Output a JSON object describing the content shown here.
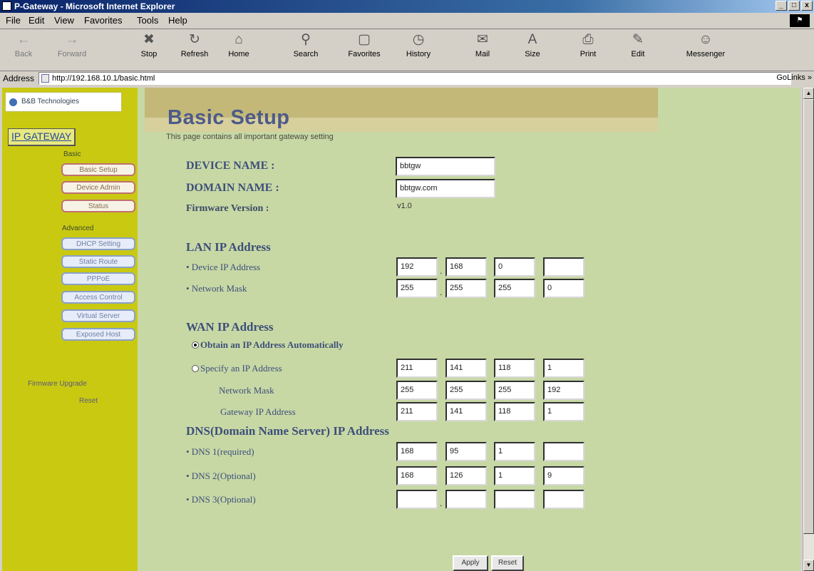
{
  "window": {
    "title": "P-Gateway - Microsoft Internet Explorer",
    "min": "_",
    "max": "□",
    "close": "x"
  },
  "menu": {
    "file": "File",
    "edit": "Edit",
    "view": "View",
    "favorites": "Favorites",
    "tools": "Tools",
    "help": "Help"
  },
  "toolbar": {
    "back": "Back",
    "forward": "Forward",
    "stop": "Stop",
    "refresh": "Refresh",
    "home": "Home",
    "search": "Search",
    "favorites": "Favorites",
    "history": "History",
    "mail": "Mail",
    "size": "Size",
    "print": "Print",
    "edit": "Edit",
    "messenger": "Messenger"
  },
  "address": {
    "label": "Address",
    "url": "http://192.168.10.1/basic.html",
    "go": "Go",
    "links": "Links »"
  },
  "nav": {
    "logo": "B&B Technologies",
    "ip_gateway": "IP GATEWAY",
    "basic_heading": "Basic",
    "basic_items": [
      "Basic Setup",
      "Device Admin",
      "Status"
    ],
    "advanced_heading": "Advanced",
    "advanced_items": [
      "DHCP Setting",
      "Static Route",
      "PPPoE",
      "Access Control",
      "Virtual Server",
      "Exposed Host"
    ],
    "firmware": "Firmware Upgrade",
    "reset": "Reset"
  },
  "page": {
    "title": "Basic Setup",
    "description": "This page contains all important gateway setting",
    "device_name_label": "DEVICE NAME :",
    "device_name_value": "bbtgw",
    "domain_name_label": "DOMAIN NAME :",
    "domain_name_value": "bbtgw.com",
    "firmware_label": "Firmware Version :",
    "firmware_value": "v1.0",
    "lan_heading": "LAN IP Address",
    "device_ip_label": "•  Device IP Address",
    "device_ip": [
      "192",
      "168",
      "0",
      ""
    ],
    "netmask_label": "•  Network Mask",
    "netmask": [
      "255",
      "255",
      "255",
      "0"
    ],
    "wan_heading": "WAN IP Address",
    "obtain_auto_label": "Obtain an IP Address Automatically",
    "specify_label": "Specify an IP Address",
    "wan_ip": [
      "211",
      "141",
      "118",
      "1"
    ],
    "wan_mask_label": "Network Mask",
    "wan_mask": [
      "255",
      "255",
      "255",
      "192"
    ],
    "gateway_label": "Gateway IP Address",
    "gateway_ip": [
      "211",
      "141",
      "118",
      "1"
    ],
    "dns_heading": "DNS(Domain Name Server) IP Address",
    "dns1_label": "•  DNS 1(required)",
    "dns1": [
      "168",
      "95",
      "1",
      ""
    ],
    "dns2_label": "•  DNS 2(Optional)",
    "dns2": [
      "168",
      "126",
      "1",
      "9"
    ],
    "dns3_label": "•  DNS 3(Optional)",
    "dns3": [
      "",
      "",
      "",
      ""
    ],
    "apply": "Apply",
    "reset": "Reset"
  }
}
